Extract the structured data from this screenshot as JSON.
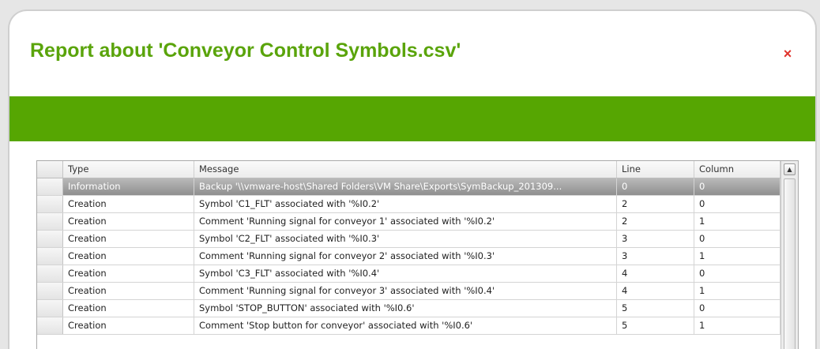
{
  "dialog": {
    "title": "Report about 'Conveyor Control Symbols.csv'",
    "close_glyph": "×",
    "close_icon": "close-icon",
    "title_color": "#5aa40b",
    "bar_color": "#56a602",
    "close_color": "#e0332c"
  },
  "table": {
    "columns": [
      "Type",
      "Message",
      "Line",
      "Column"
    ],
    "rows": [
      {
        "type": "Information",
        "message": "Backup '\\\\vmware-host\\Shared Folders\\VM Share\\Exports\\SymBackup_201309...",
        "line": "0",
        "column": "0",
        "selected": true
      },
      {
        "type": "Creation",
        "message": "Symbol 'C1_FLT' associated with '%I0.2'",
        "line": "2",
        "column": "0"
      },
      {
        "type": "Creation",
        "message": "Comment 'Running signal for conveyor 1' associated with '%I0.2'",
        "line": "2",
        "column": "1"
      },
      {
        "type": "Creation",
        "message": "Symbol 'C2_FLT' associated with '%I0.3'",
        "line": "3",
        "column": "0"
      },
      {
        "type": "Creation",
        "message": "Comment 'Running signal for conveyor 2' associated with '%I0.3'",
        "line": "3",
        "column": "1"
      },
      {
        "type": "Creation",
        "message": "Symbol 'C3_FLT' associated with '%I0.4'",
        "line": "4",
        "column": "0"
      },
      {
        "type": "Creation",
        "message": "Comment 'Running signal for conveyor 3' associated with '%I0.4'",
        "line": "4",
        "column": "1"
      },
      {
        "type": "Creation",
        "message": "Symbol 'STOP_BUTTON' associated with '%I0.6'",
        "line": "5",
        "column": "0"
      },
      {
        "type": "Creation",
        "message": "Comment 'Stop button for conveyor' associated with '%I0.6'",
        "line": "5",
        "column": "1"
      }
    ],
    "scroll_up_glyph": "▲",
    "scroll_up_icon": "scroll-up-icon"
  }
}
